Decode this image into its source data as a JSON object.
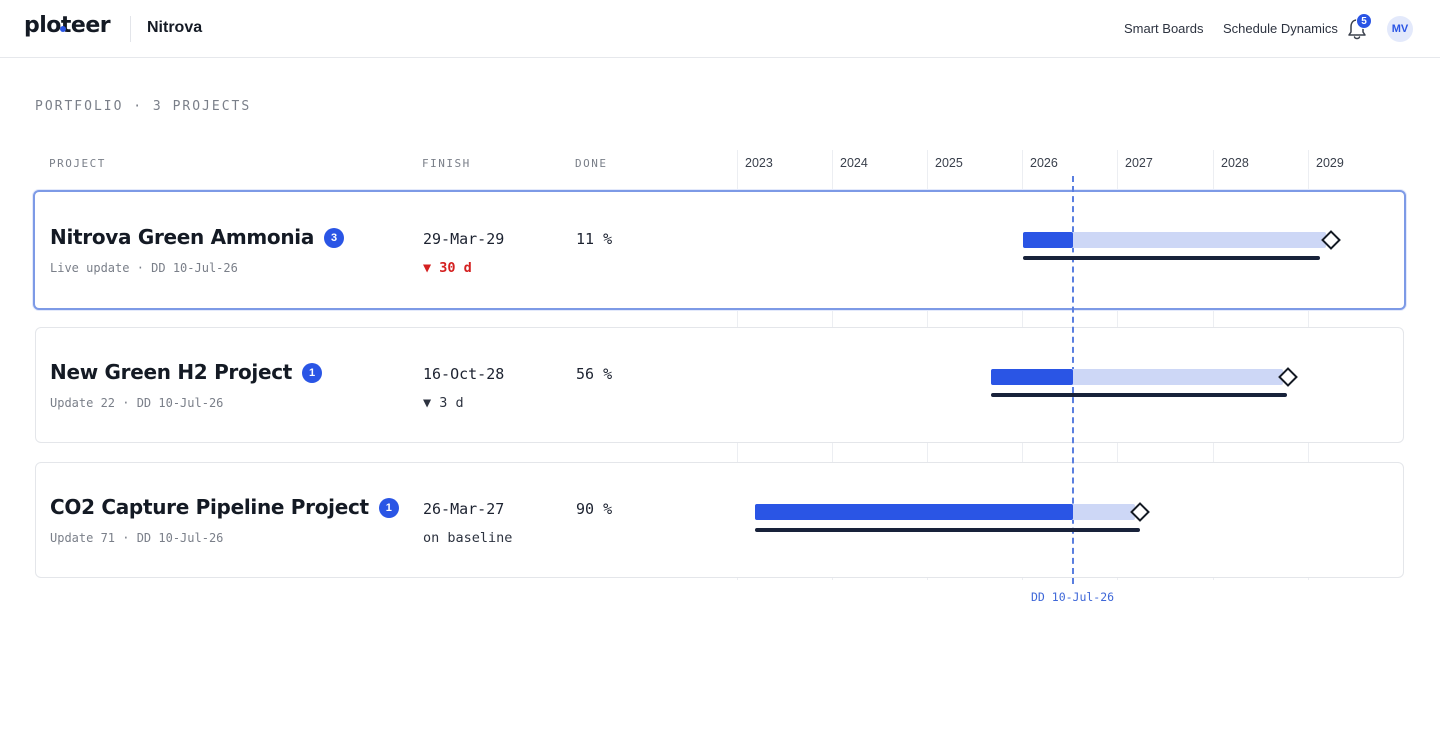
{
  "app": {
    "logo": "ploteer",
    "org": "Nitrova",
    "nav": {
      "smart_boards": "Smart Boards",
      "schedule_dynamics": "Schedule Dynamics"
    },
    "notifications": {
      "count": "5",
      "icon": "bell-icon"
    },
    "user_initials": "MV"
  },
  "portfolio": {
    "title": "PORTFOLIO · 3 PROJECTS",
    "columns": {
      "project": "PROJECT",
      "finish": "FINISH",
      "done": "DONE"
    },
    "years": [
      "2023",
      "2024",
      "2025",
      "2026",
      "2027",
      "2028",
      "2029"
    ],
    "data_date_label": "DD 10-Jul-26",
    "projects": [
      {
        "name": "Nitrova Green Ammonia",
        "badge": "3",
        "subtitle": "Live update · DD 10-Jul-26",
        "finish": "29-Mar-29",
        "delay": "▼ 30 d",
        "delay_status": "late",
        "done": "11 %",
        "done_fraction": 0.11,
        "selected": true
      },
      {
        "name": "New Green H2 Project",
        "badge": "1",
        "subtitle": "Update 22 · DD 10-Jul-26",
        "finish": "16-Oct-28",
        "delay": "▼ 3 d",
        "delay_status": "minor",
        "done": "56 %",
        "done_fraction": 0.56,
        "selected": false
      },
      {
        "name": "CO2 Capture Pipeline Project",
        "badge": "1",
        "subtitle": "Update 71 · DD 10-Jul-26",
        "finish": "26-Mar-27",
        "delay": "on baseline",
        "delay_status": "ok",
        "done": "90 %",
        "done_fraction": 0.9,
        "selected": false
      }
    ]
  },
  "colors": {
    "accent": "#2a55e5",
    "plan_bar": "#cdd7f6",
    "baseline_bar": "#18223a",
    "late": "#d42020",
    "selected_border": "#7d9ae6"
  }
}
